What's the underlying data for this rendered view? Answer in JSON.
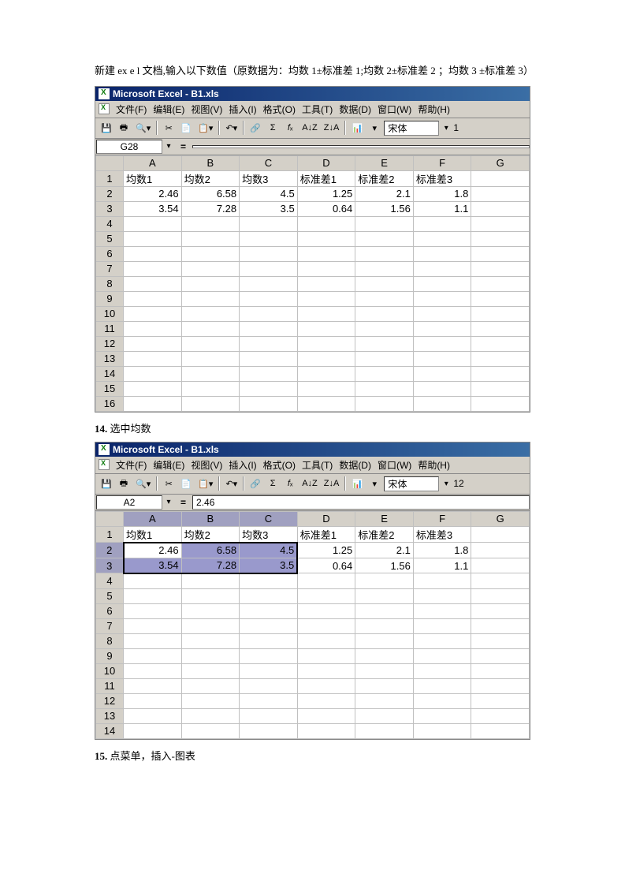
{
  "intro": "新建 ex e l 文档,输入以下数值（原数据为：均数 1±标准差 1;均数 2±标准差 2 ；均数 3 ±标准差 3）",
  "step14": "选中均数",
  "step14_num": "14.",
  "step15": "点菜单，插入-图表",
  "step15_num": "15.",
  "excel": {
    "title": "Microsoft Excel - B1.xls",
    "menus": [
      "文件(F)",
      "编辑(E)",
      "视图(V)",
      "插入(I)",
      "格式(O)",
      "工具(T)",
      "数据(D)",
      "窗口(W)",
      "帮助(H)"
    ],
    "font": "宋体",
    "fontsize1": "1",
    "fontsize2": "12"
  },
  "grid": {
    "cols": [
      "A",
      "B",
      "C",
      "D",
      "E",
      "F",
      "G"
    ],
    "headers": [
      "均数1",
      "均数2",
      "均数3",
      "标准差1",
      "标准差2",
      "标准差3",
      ""
    ],
    "rows": [
      [
        "2.46",
        "6.58",
        "4.5",
        "1.25",
        "2.1",
        "1.8",
        ""
      ],
      [
        "3.54",
        "7.28",
        "3.5",
        "0.64",
        "1.56",
        "1.1",
        ""
      ]
    ],
    "empty_rows1": [
      4,
      5,
      6,
      7,
      8,
      9,
      10,
      11,
      12,
      13,
      14,
      15,
      16
    ],
    "empty_rows2": [
      4,
      5,
      6,
      7,
      8,
      9,
      10,
      11,
      12,
      13,
      14
    ]
  },
  "sheet1": {
    "namebox": "G28",
    "formula": ""
  },
  "sheet2": {
    "namebox": "A2",
    "formula": "2.46"
  }
}
